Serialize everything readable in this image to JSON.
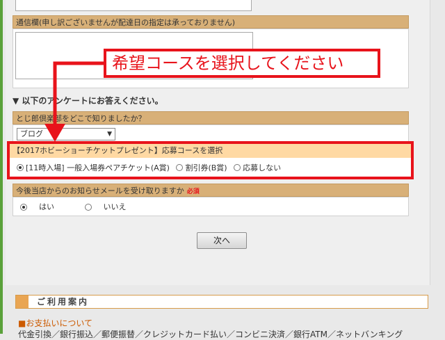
{
  "form": {
    "communication_label": "通信欄(申し訳ございませんが配達日の指定は承っておりません)",
    "survey_title": "▼ 以下のアンケートにお答えください。",
    "q1_label": "とじ郎倶楽部をどこで知りましたか？",
    "q1_select_value": "ブログ",
    "campaign_label": "【2017ホビーショーチケットプレゼント】応募コースを選択",
    "campaign_options": [
      "[11時入場] 一般入場券ペアチケット(A賞)",
      "割引券(B賞)",
      "応募しない"
    ],
    "mail_label": "今後当店からのお知らせメールを受け取りますか",
    "required_badge": "必須",
    "mail_options": [
      "はい",
      "いいえ"
    ],
    "next_button": "次へ"
  },
  "annotation": {
    "callout_text": "希望コースを選択してください",
    "color": "#e8131b"
  },
  "guide": {
    "title": "ご利用案内",
    "payment_link": "■お支払いについて",
    "payment_methods": "代金引換／銀行振込／郵便振替／クレジットカード払い／コンビニ決済／銀行ATM／ネットバンキング"
  }
}
